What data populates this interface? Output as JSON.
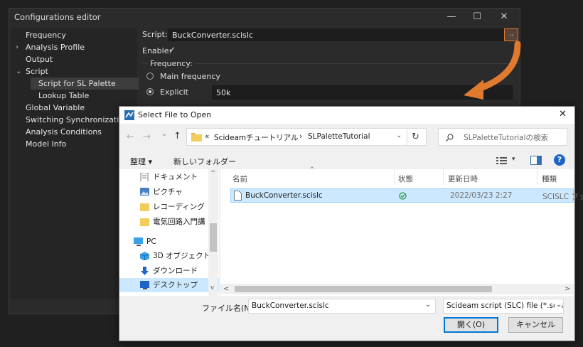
{
  "config": {
    "title": "Configurations editor",
    "window_buttons": {
      "minimize": "—",
      "maximize": "☐",
      "close": "✕"
    },
    "tree": [
      {
        "label": "Frequency",
        "arrow": ""
      },
      {
        "label": "Analysis Profile",
        "arrow": "›"
      },
      {
        "label": "Output",
        "arrow": ""
      },
      {
        "label": "Script",
        "arrow": "⌄"
      },
      {
        "label": "Script for SL Palette",
        "arrow": "",
        "selected": true
      },
      {
        "label": "Lookup Table",
        "arrow": ""
      },
      {
        "label": "Global Variable",
        "arrow": ""
      },
      {
        "label": "Switching Synchronization",
        "arrow": ""
      },
      {
        "label": "Analysis Conditions",
        "arrow": ""
      },
      {
        "label": "Model Info",
        "arrow": ""
      }
    ],
    "script_label": "Script:",
    "script_value": "BuckConverter.scislc",
    "browse_label": "..",
    "enable_label": "Enable:",
    "enable_checked": "✓",
    "frequency_group": "Frequency:",
    "main_frequency_label": "Main frequency",
    "explicit_label": "Explicit",
    "explicit_value": "50k",
    "accent_arrow_color": "#e07a2e"
  },
  "dialog": {
    "title": "Select File to Open",
    "close": "✕",
    "nav_back": "←",
    "nav_forward": "→",
    "nav_recent": "⌄",
    "nav_up": "↑",
    "breadcrumb_prefix": "«",
    "breadcrumb_1": "Scideamチュートリアル",
    "breadcrumb_sep": "›",
    "breadcrumb_2": "SLPaletteTutorial",
    "breadcrumb_drop": "⌄",
    "refresh": "↻",
    "search_placeholder": "SLPaletteTutorialの検索",
    "organize_label": "整理 ▾",
    "new_folder_label": "新しいフォルダー",
    "view_drop": "▾",
    "help": "?",
    "nav_items": [
      {
        "label": "ドキュメント",
        "icon": "document-icon"
      },
      {
        "label": "ピクチャ",
        "icon": "picture-icon"
      },
      {
        "label": "レコーディング",
        "icon": "folder-icon"
      },
      {
        "label": "電気回路入門講",
        "icon": "folder-icon"
      },
      {
        "label": "PC",
        "icon": "pc-icon"
      },
      {
        "label": "3D オブジェクト",
        "icon": "3d-objects-icon"
      },
      {
        "label": "ダウンロード",
        "icon": "download-icon"
      },
      {
        "label": "デスクトップ",
        "icon": "desktop-icon",
        "selected": true
      }
    ],
    "columns": {
      "name": "名前",
      "status": "状態",
      "date": "更新日時",
      "type": "種類"
    },
    "sort_indicator": "^",
    "files": [
      {
        "name": "BuckConverter.scislc",
        "status_icon": "sync-ok-icon",
        "date": "2022/03/23 2:27",
        "type": "SCISLC ファ"
      }
    ],
    "filename_label": "ファイル名(N):",
    "filename_value": "BuckConverter.scislc",
    "filetype_value": "Scideam script (SLC) file (*.scislc)",
    "open_button": "開く(O)",
    "cancel_button": "キャンセル",
    "scroll_left": "<",
    "scroll_right": ">",
    "scroll_up": "^",
    "scroll_down": "v"
  }
}
